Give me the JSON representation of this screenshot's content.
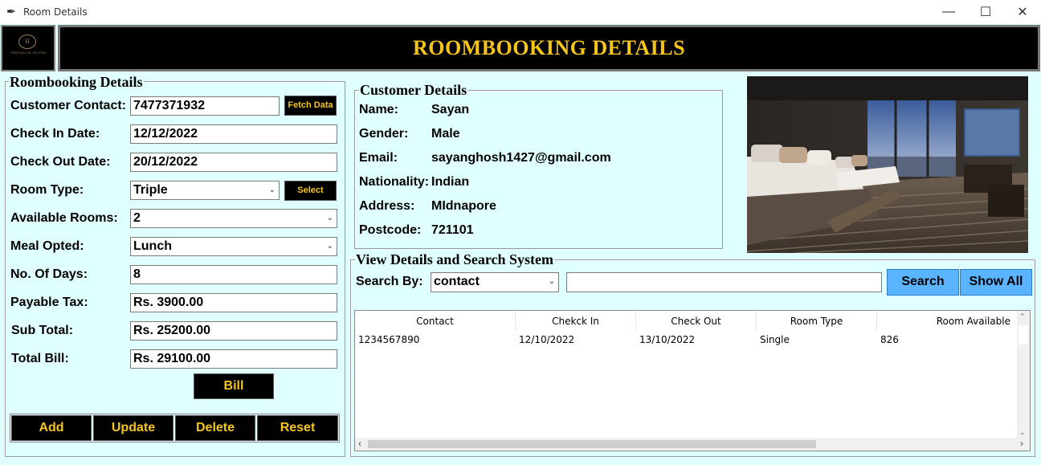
{
  "window": {
    "title": "Room Details",
    "min_icon": "minimize-icon",
    "max_icon": "maximize-icon",
    "close_icon": "close-icon"
  },
  "header": {
    "title": "ROOMBOOKING DETAILS",
    "logo_text": "PREMIUM HOTEL",
    "logo_monogram": "H"
  },
  "colors": {
    "background": "#e0ffff",
    "header_bg": "#000000",
    "accent": "#f5c518",
    "button_blue": "#5ab4ff"
  },
  "booking": {
    "frame_title": "Roombooking Details",
    "fields": {
      "customer_contact": {
        "label": "Customer Contact:",
        "value": "7477371932"
      },
      "check_in": {
        "label": "Check In Date:",
        "value": "12/12/2022"
      },
      "check_out": {
        "label": "Check Out Date:",
        "value": "20/12/2022"
      },
      "room_type": {
        "label": "Room Type:",
        "value": "Triple"
      },
      "available_rooms": {
        "label": "Available Rooms:",
        "value": "2"
      },
      "meal": {
        "label": "Meal Opted:",
        "value": "Lunch"
      },
      "days": {
        "label": "No. Of Days:",
        "value": "8"
      },
      "tax": {
        "label": "Payable Tax:",
        "value": "Rs. 3900.00"
      },
      "sub_total": {
        "label": "Sub Total:",
        "value": "Rs. 25200.00"
      },
      "total_bill": {
        "label": "Total Bill:",
        "value": "Rs. 29100.00"
      }
    },
    "fetch_label": "Fetch Data",
    "select_label": "Select",
    "bill_label": "Bill",
    "actions": {
      "add": "Add",
      "update": "Update",
      "delete": "Delete",
      "reset": "Reset"
    }
  },
  "customer": {
    "frame_title": "Customer Details",
    "rows": [
      {
        "label": "Name:",
        "value": "Sayan"
      },
      {
        "label": "Gender:",
        "value": "Male"
      },
      {
        "label": "Email:",
        "value": "sayanghosh1427@gmail.com"
      },
      {
        "label": "Nationality:",
        "value": "Indian"
      },
      {
        "label": "Address:",
        "value": "MIdnapore"
      },
      {
        "label": "Postcode:",
        "value": "721101"
      }
    ]
  },
  "search": {
    "frame_title": "View Details and Search System",
    "search_by_label": "Search By:",
    "search_by_value": "contact",
    "search_text": "",
    "search_button": "Search",
    "show_all_button": "Show All"
  },
  "table": {
    "columns": [
      "Contact",
      "Chekck In",
      "Check Out",
      "Room Type",
      "Room Available"
    ],
    "rows": [
      [
        "1234567890",
        "12/10/2022",
        "13/10/2022",
        "Single",
        "826"
      ]
    ]
  }
}
